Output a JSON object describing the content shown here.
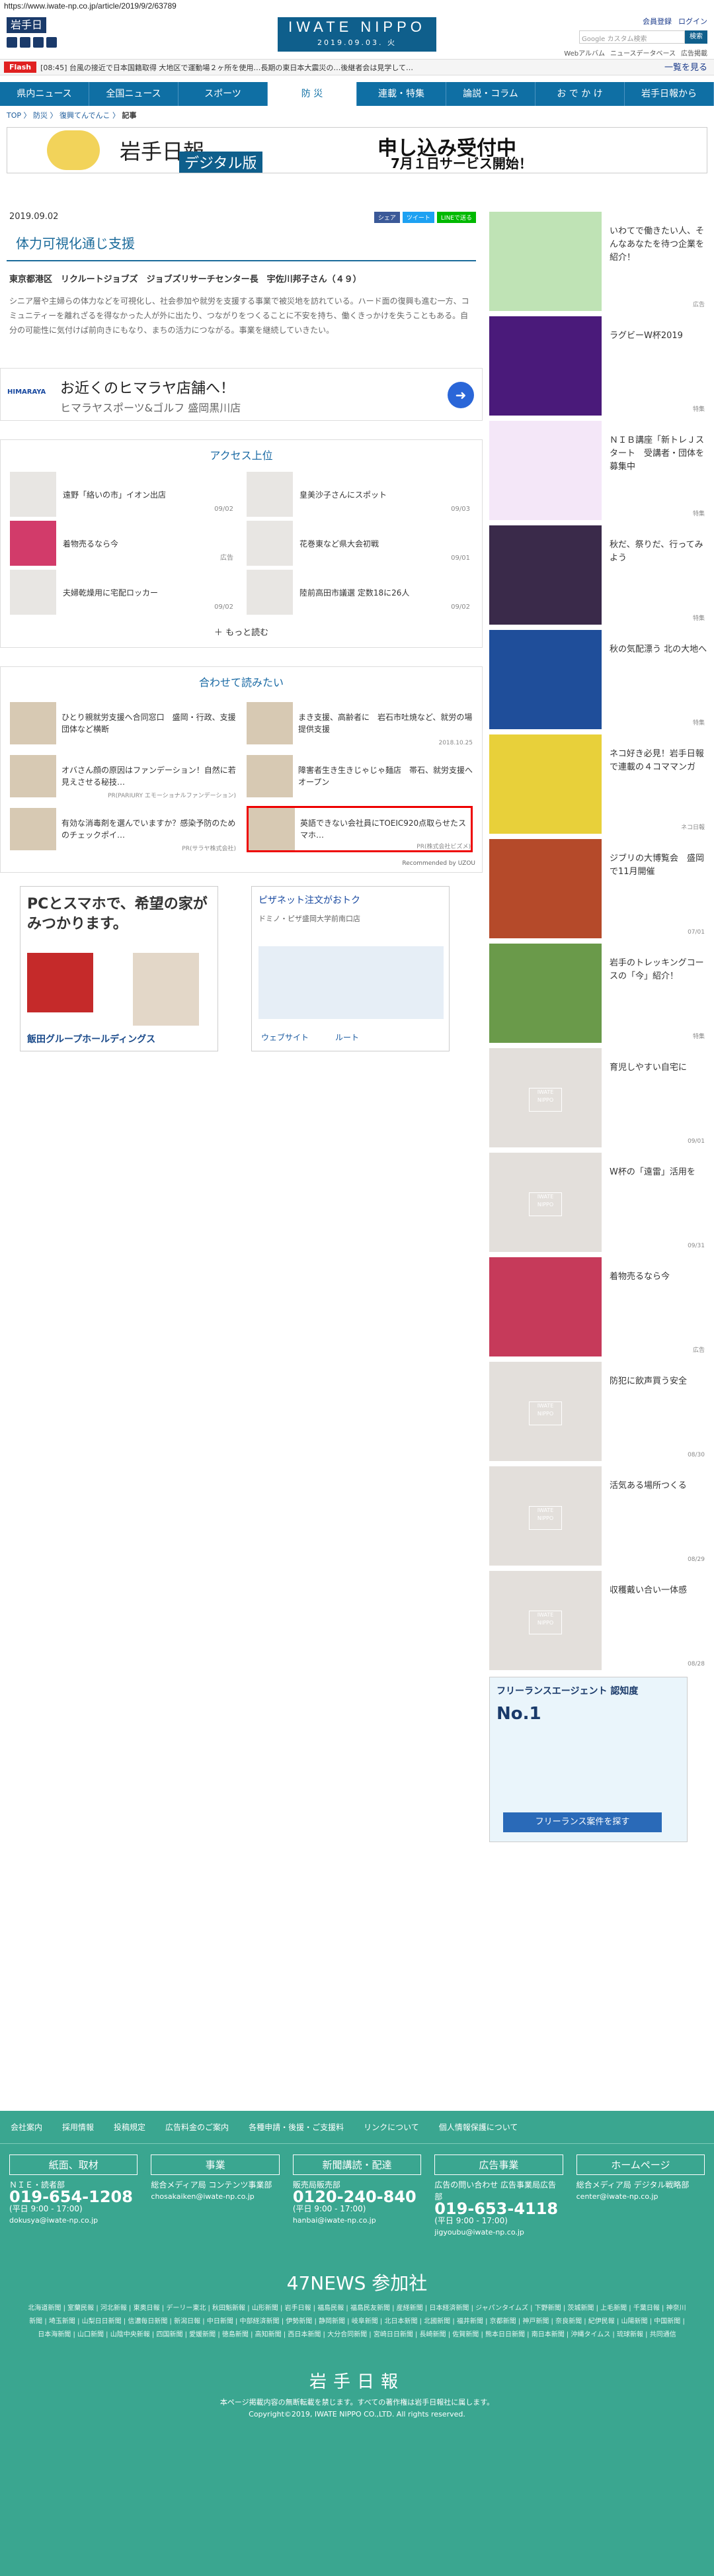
{
  "url": "https://www.iwate-np.co.jp/article/2019/9/2/63789",
  "header": {
    "site_name": "岩手日報",
    "center_title": "IWATE NIPPO",
    "center_date": "2019.09.03. 火",
    "member_login": "会員登録",
    "login": "ログイン",
    "search_placeholder": "Google カスタム検索",
    "search_button": "検索",
    "sublinks": [
      "Webアルバム",
      "ニュースデータベース",
      "広告掲載"
    ]
  },
  "flash": {
    "label": "Flash",
    "text": "[08:45] 台風の接近で日本国籍取得 大地区で運動場２ヶ所を使用…長期の東日本大震災の…後継者会は見学して…",
    "more": "一覧を見る"
  },
  "nav": [
    "県内ニュース",
    "全国ニュース",
    "スポーツ",
    "防 災",
    "連載・特集",
    "論説・コラム",
    "お で か け",
    "岩手日報から"
  ],
  "breadcrumb": [
    "TOP",
    "防災",
    "復興てんでんこ"
  ],
  "breadcrumb_current": "記事",
  "banner": {
    "title": "岩手日報",
    "sub": "デジタル版",
    "r1": "申し込み受付中",
    "r2": "7月１日サービス開始！"
  },
  "article": {
    "date": "2019.09.02",
    "share": [
      "シェア",
      "ツイート",
      "LINEで送る"
    ],
    "title": "体力可視化通じ支援",
    "byline": "東京都港区　リクルートジョブズ　ジョブズリサーチセンター長　宇佐川邦子さん（４９）",
    "body": "シニア層や主婦らの体力などを可視化し、社会参加や就労を支援する事業で被災地を訪れている。ハード面の復興も進む一方、コミュニティーを離れざるを得なかった人が外に出たり、つながりをつくることに不安を持ち、働くきっかけを失うこともある。自分の可能性に気付けば前向きにもなり、まちの活力につながる。事業を継続していきたい。"
  },
  "store_ad": {
    "logo": "HIMARAYA",
    "name": "お近くのヒマラヤ店舗へ！",
    "sub": "ヒマラヤスポーツ&ゴルフ 盛岡黒川店"
  },
  "access": {
    "heading": "アクセス上位",
    "items": [
      {
        "text": "遠野「絡いの市」イオン出店",
        "date": "09/02"
      },
      {
        "text": "皇美沙子さんにスポット",
        "date": "09/03"
      },
      {
        "text": "着物売るなら今",
        "date": "広告"
      },
      {
        "text": "花巻東など県大会初戦",
        "date": "09/01"
      },
      {
        "text": "夫婦乾燥用に宅配ロッカー",
        "date": "09/02"
      },
      {
        "text": "陸前高田市議選 定数18に26人",
        "date": "09/02"
      }
    ],
    "more": "もっと読む"
  },
  "recommend": {
    "heading": "合わせて読みたい",
    "items": [
      {
        "text": "ひとり親就労支援へ合同窓口　盛岡・行政、支援団体など横断",
        "sponsor": ""
      },
      {
        "text": "まき支援、高齢者に　岩石市吐焼など、就労の場提供支援",
        "sponsor": "2018.10.25"
      },
      {
        "text": "オバさん顔の原因はファンデーション！自然に若見えさせる秘技…",
        "sponsor": "PR(PARIURY エモーショナルファンデーション)"
      },
      {
        "text": "障害者生き生きじゃじゃ麺店　帯石、就労支援へオープン",
        "sponsor": ""
      },
      {
        "text": "有効な消毒剤を選んでいますか？感染予防のためのチェックポイ…",
        "sponsor": "PR(サラヤ株式会社)"
      },
      {
        "text": "英語できない会社員にTOEIC920点取らせたスマホ…",
        "sponsor": "PR(株式会社ビズメ)"
      }
    ],
    "footer": "Recommended by UZOU"
  },
  "ads": {
    "ad1_head": "PCとスマホで、希望の家がみつかります。",
    "ad1_foot": "飯田グループホールディングス",
    "ad2_head": "ピザネット注文がおトク",
    "ad2_sub": "ドミノ・ピザ盛岡大学前南口店",
    "ad2_btn1": "ウェブサイト",
    "ad2_btn2": "ルート"
  },
  "sidebar": {
    "items": [
      {
        "text": "いわてで働きたい人、そんなあなたを待つ企業を紹介！",
        "date": "広告"
      },
      {
        "text": "ラグビーW杯2019",
        "date": "特集"
      },
      {
        "text": "ＮＩＢ講座「新トレＪスタート　受講者・団体を募集中",
        "date": "特集"
      },
      {
        "text": "秋だ、祭りだ、行ってみよう",
        "date": "特集"
      },
      {
        "text": "秋の気配漂う 北の大地へ",
        "date": "特集"
      },
      {
        "text": "ネコ好き必見！岩手日報で連載の４コママンガ",
        "date": "ネコ日報"
      },
      {
        "text": "ジブリの大博覧会　盛岡で11月開催",
        "date": "07/01"
      },
      {
        "text": "岩手のトレッキングコースの「今」紹介！",
        "date": "特集"
      },
      {
        "text": "育児しやすい自宅に",
        "date": "09/01"
      },
      {
        "text": "W杯の「遠雷」活用を",
        "date": "09/31"
      },
      {
        "text": "着物売るなら今",
        "date": "広告"
      },
      {
        "text": "防犯に飲声買う安全",
        "date": "08/30"
      },
      {
        "text": "活気ある場所つくる",
        "date": "08/29"
      },
      {
        "text": "収穫戴い合い一体感",
        "date": "08/28"
      }
    ],
    "ad_head": "フリーランスエージェント 認知度",
    "ad_no": "No.1",
    "ad_btn": "フリーランス案件を探す"
  },
  "footer": {
    "links": [
      "会社案内",
      "採用情報",
      "投稿規定",
      "広告料金のご案内",
      "各種申請・後援・ご支援料",
      "リンクについて",
      "個人情報保護について"
    ],
    "cols": [
      {
        "h": "紙面、取材",
        "t1": "ＮＩＥ・読者部",
        "tel": "019-654-1208",
        "hours": "(平日 9:00 - 17:00)",
        "mail": "dokusya@iwate-np.co.jp"
      },
      {
        "h": "事業",
        "t1": "総合メディア局 コンテンツ事業部",
        "tel": "",
        "hours": "",
        "mail": "chosakaiken@iwate-np.co.jp"
      },
      {
        "h": "新聞講読・配達",
        "t1": "販売局販売部",
        "tel": "0120-240-840",
        "hours": "(平日 9:00 - 17:00)",
        "mail": "hanbai@iwate-np.co.jp"
      },
      {
        "h": "広告事業",
        "t1": "広告の問い合わせ 広告事業局広告部",
        "tel": "019-653-4118",
        "hours": "(平日 9:00 - 17:00)",
        "mail": "jigyoubu@iwate-np.co.jp"
      },
      {
        "h": "ホームページ",
        "t1": "総合メディア局 デジタル戦略部",
        "tel": "",
        "hours": "",
        "mail": "center@iwate-np.co.jp"
      }
    ],
    "news47": "47NEWS 参加社",
    "papers": "北海道新聞 | 室蘭民報 | 河北新報 | 東奥日報 | デーリー東北 | 秋田魁新報 | 山形新聞 | 岩手日報 | 福島民報 | 福島民友新聞 | 産経新聞 | 日本経済新聞 | ジャパンタイムズ | 下野新聞 | 茨城新聞 | 上毛新聞 | 千葉日報 | 神奈川新聞 | 埼玉新聞 | 山梨日日新聞 | 信濃毎日新聞 | 新潟日報 | 中日新聞 | 中部経済新聞 | 伊勢新聞 | 静岡新聞 | 岐阜新聞 | 北日本新聞 | 北國新聞 | 福井新聞 | 京都新聞 | 神戸新聞 | 奈良新聞 | 紀伊民報 | 山陽新聞 | 中国新聞 | 日本海新聞 | 山口新聞 | 山陰中央新報 | 四国新聞 | 愛媛新聞 | 徳島新聞 | 高知新聞 | 西日本新聞 | 大分合同新聞 | 宮崎日日新聞 | 長崎新聞 | 佐賀新聞 | 熊本日日新聞 | 南日本新聞 | 沖縄タイムス | 琉球新報 | 共同通信",
    "logo": "岩手日報",
    "copy1": "本ページ掲載内容の無断転載を禁じます。すべての著作権は岩手日報社に属します。",
    "copy2": "Copyright©2019, IWATE NIPPO CO.,LTD. All rights reserved."
  }
}
